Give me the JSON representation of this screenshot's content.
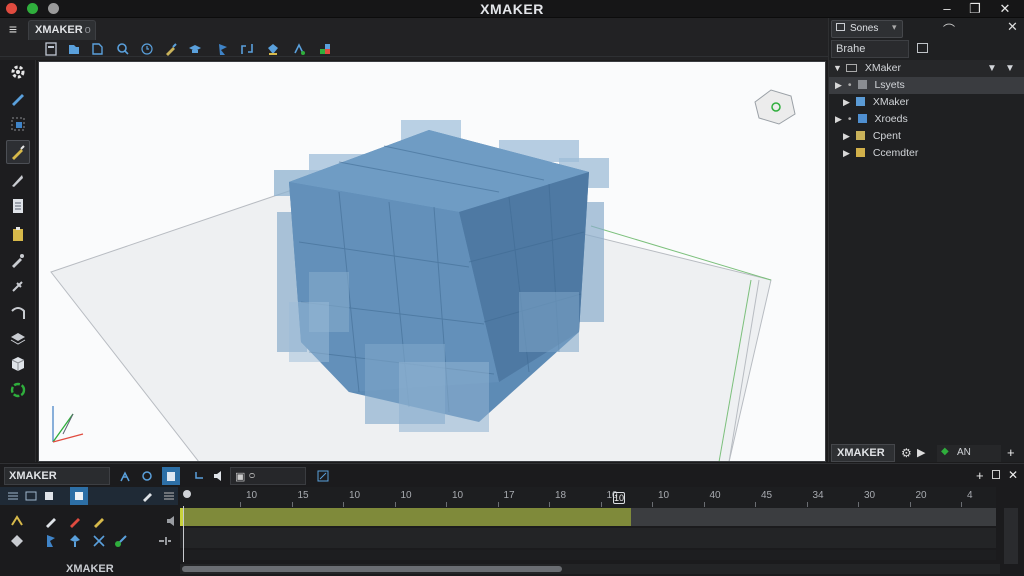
{
  "window": {
    "title": "XMAKER",
    "minimize_glyph": "–",
    "maximize_glyph": "❐",
    "close_glyph": "✕",
    "traffic_colors": [
      "#e04b3f",
      "#2fae3c",
      "#9a9a9a"
    ]
  },
  "header": {
    "menu_glyph": "≡",
    "doc_tab": "XMAKER",
    "doc_tab_suffix": "o"
  },
  "right_panel": {
    "tab_label": "Sones",
    "tab_icon": "folder-icon",
    "filter_label": "Brahe",
    "root_label": "XMaker",
    "items": [
      {
        "label": "Lsyets",
        "prefix": "•",
        "color": "#8a8d92",
        "selected": true
      },
      {
        "label": "XMaker",
        "prefix": "",
        "color": "#5b9bd5",
        "selected": false
      },
      {
        "label": "Xroeds",
        "prefix": "•",
        "color": "#4f8fd0",
        "selected": false
      },
      {
        "label": "Cpent",
        "prefix": "",
        "color": "#c9b25a",
        "selected": false
      },
      {
        "label": "Ccemdter",
        "prefix": "",
        "color": "#d1b04a",
        "selected": false
      }
    ],
    "bottom_tab_1": "XMAKER",
    "bottom_tab_2": "AN",
    "add_glyph": "+"
  },
  "bottom": {
    "tab_label": "XMAKER",
    "footer_label": "XMAKER",
    "add_glyph": "+",
    "close_glyph": "✕",
    "ruler_labels": [
      "10",
      "15",
      "10",
      "10",
      "10",
      "17",
      "18",
      "10",
      "10",
      "40",
      "45",
      "34",
      "30",
      "20",
      "4"
    ],
    "playhead_frame": "10",
    "work_area_fraction": 0.55
  },
  "colors": {
    "accent": "#2d6fa6",
    "cube": "#4f7fa8",
    "timeline_bar": "#8a8f3c"
  }
}
